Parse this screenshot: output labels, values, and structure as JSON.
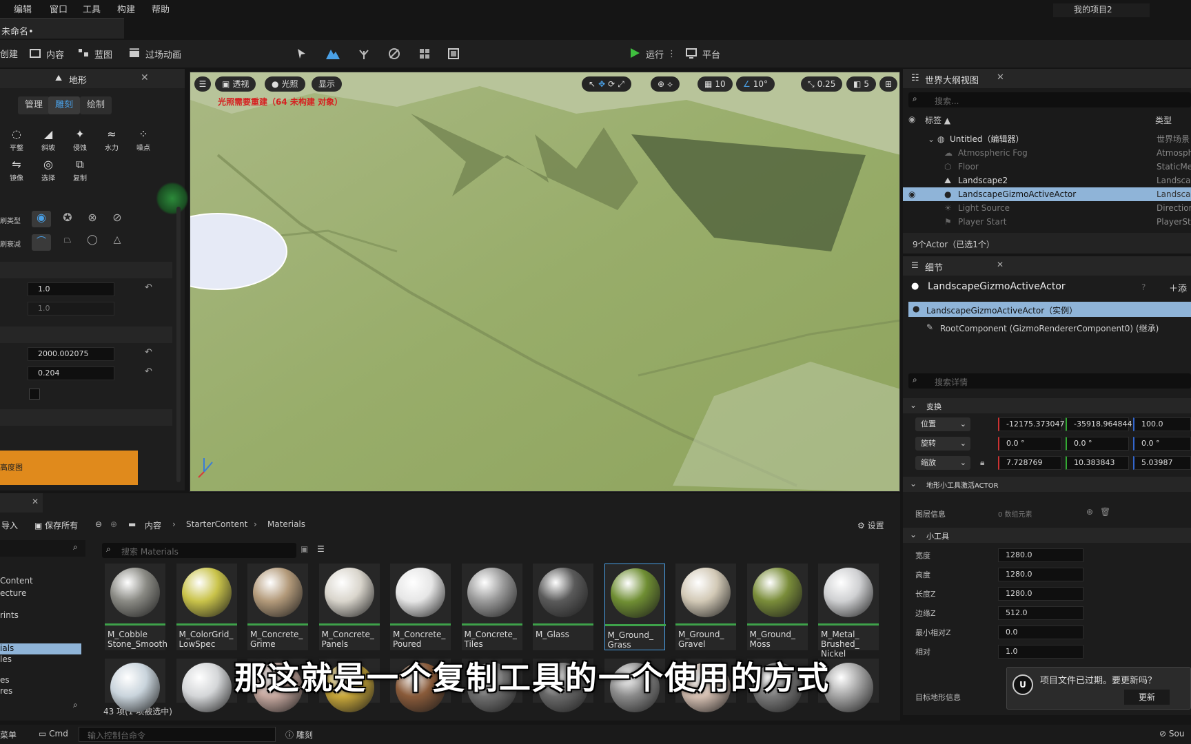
{
  "menu": {
    "items": [
      "编辑",
      "窗口",
      "工具",
      "构建",
      "帮助"
    ],
    "project": "我的项目2"
  },
  "tab": {
    "title": "未命名•"
  },
  "toolbar": {
    "create": "创建",
    "content": "内容",
    "blueprint": "蓝图",
    "cinematics": "过场动画",
    "run": "运行",
    "platform": "平台"
  },
  "landscape": {
    "panel_title": "地形",
    "tabs": [
      "管理",
      "雕刻",
      "绘制"
    ],
    "tools_row1": [
      {
        "glyph": "◌",
        "label": "平整"
      },
      {
        "glyph": "◢",
        "label": "斜坡"
      },
      {
        "glyph": "✦",
        "label": "侵蚀"
      },
      {
        "glyph": "≈",
        "label": "水力"
      },
      {
        "glyph": "⁘",
        "label": "噪点"
      }
    ],
    "tools_row2": [
      {
        "glyph": "⇋",
        "label": "镜像"
      },
      {
        "glyph": "◎",
        "label": "选择"
      },
      {
        "glyph": "⧉",
        "label": "复制"
      }
    ],
    "brush_type_label": "刷类型",
    "brush_falloff_label": "刷衰减",
    "strength_value": "1.0",
    "strength_value2": "1.0",
    "size_value": "2000.002075",
    "falloff_value": "0.204",
    "orange_button": "高度图"
  },
  "viewport": {
    "perspective": "透视",
    "lit": "光照",
    "show": "显示",
    "warning": "光照需要重建（64 未构建 对象）",
    "grid_snap": "10",
    "rot_snap": "10°",
    "scale_snap": "0.25",
    "camera_speed": "5"
  },
  "outliner": {
    "title": "世界大纲视图",
    "search_placeholder": "搜索...",
    "col_label": "标签 ▲",
    "col_type": "类型",
    "rows": [
      {
        "name": "Untitled（编辑器）",
        "type": "世界场景"
      },
      {
        "name": "Atmospheric Fog",
        "type": "Atmosph"
      },
      {
        "name": "Floor",
        "type": "StaticMe"
      },
      {
        "name": "Landscape2",
        "type": "Landsca"
      },
      {
        "name": "LandscapeGizmoActiveActor",
        "type": "Landsca"
      },
      {
        "name": "Light Source",
        "type": "Direction"
      },
      {
        "name": "Player Start",
        "type": "PlayerSt"
      }
    ],
    "footer": "9个Actor（已选1个）"
  },
  "details": {
    "title": "细节",
    "actor_name": "LandscapeGizmoActiveActor",
    "add": "添",
    "instance": "LandscapeGizmoActiveActor（实例）",
    "root": "RootComponent (GizmoRendererComponent0) (继承)",
    "search_placeholder": "搜索详情",
    "transform": "变换",
    "location_label": "位置",
    "rotation_label": "旋转",
    "scale_label": "缩放",
    "loc": [
      "-12175.373047",
      "-35918.964844",
      "100.0"
    ],
    "rot": [
      "0.0 °",
      "0.0 °",
      "0.0 °"
    ],
    "scale": [
      "7.728769",
      "10.383843",
      "5.03987"
    ],
    "gizmo_section": "地形小工具激活ACTOR",
    "layer_info_label": "图层信息",
    "layer_info_value": "0 数组元素",
    "tools_section": "小工具",
    "width_label": "宽度",
    "width": "1280.0",
    "height_label": "高度",
    "height": "1280.0",
    "lengthz_label": "长度Z",
    "lengthz": "1280.0",
    "marginz_label": "边缘Z",
    "marginz": "512.0",
    "minrel_label": "最小相对Z",
    "minrel": "0.0",
    "rel_label": "相对",
    "rel": "1.0",
    "target_label": "目标地形信息"
  },
  "content_browser": {
    "import": "导入",
    "save_all": "保存所有",
    "crumbs": [
      "内容",
      "StarterContent",
      "Materials"
    ],
    "settings": "设置",
    "search_placeholder": "搜索 Materials",
    "tree": [
      "Content",
      "ecture",
      "rints",
      "ials",
      "les",
      "es",
      "res"
    ],
    "status": "43 项(1 项被选中)",
    "assets": [
      {
        "name": "M_Cobble Stone_Smooth",
        "color": "#8a8a84"
      },
      {
        "name": "M_ColorGrid_ LowSpec",
        "color": "#c9c34a"
      },
      {
        "name": "M_Concrete_ Grime",
        "color": "#b39a7a"
      },
      {
        "name": "M_Concrete_ Panels",
        "color": "#d9d5cc"
      },
      {
        "name": "M_Concrete_ Poured",
        "color": "#e6e6e6"
      },
      {
        "name": "M_Concrete_ Tiles",
        "color": "#9a9a9a"
      },
      {
        "name": "M_Glass",
        "color": "#5a5a5a"
      },
      {
        "name": "M_Ground_ Grass",
        "color": "#6f8e33"
      },
      {
        "name": "M_Ground_ Gravel",
        "color": "#d2c9b6"
      },
      {
        "name": "M_Ground_ Moss",
        "color": "#7a8d3a"
      },
      {
        "name": "M_Metal_ Brushed_ Nickel",
        "color": "#cfd0d2"
      }
    ]
  },
  "status": {
    "content_drawer": "菜单",
    "cmd": "Cmd",
    "console_placeholder": "输入控制台命令",
    "mode": "雕刻",
    "source": "Sou"
  },
  "subtitle": "那这就是一个复制工具的一个使用的方式",
  "toast": {
    "message": "项目文件已过期。要更新吗？",
    "update": "更新"
  }
}
